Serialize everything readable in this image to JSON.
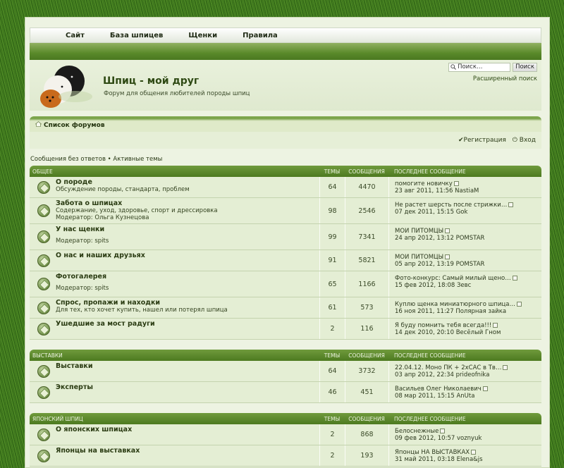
{
  "nav": [
    "Сайт",
    "База шпицев",
    "Щенки",
    "Правила"
  ],
  "site": {
    "title": "Шпиц - мой друг",
    "description": "Форум для общения любителей породы шпиц"
  },
  "search": {
    "placeholder": "Поиск…",
    "button": "Поиск",
    "advanced": "Расширенный поиск"
  },
  "breadcrumb": "Список форумов",
  "user_links": {
    "register": "Регистрация",
    "login": "Вход"
  },
  "quick_links": "Сообщения без ответов • Активные темы",
  "columns": {
    "topics": "ТЕМЫ",
    "posts": "СООБЩЕНИЯ",
    "last_post": "ПОСЛЕДНЕЕ СООБЩЕНИЕ"
  },
  "categories": [
    {
      "name": "ОБЩЕЕ",
      "forums": [
        {
          "name": "О породе",
          "desc": "Обсуждение породы, стандарта, проблем",
          "moderator": "",
          "topics": "64",
          "posts": "4470",
          "last_title": "помогите новичку",
          "last_meta": "23 авг 2011, 11:56 NastiaM"
        },
        {
          "name": "Забота о шпицах",
          "desc": "Содержание, уход, здоровье, спорт и дрессировка",
          "moderator": "Модератор: Ольга Кузнецова",
          "topics": "98",
          "posts": "2546",
          "last_title": "Не растет шерсть после стрижки…",
          "last_meta": "07 дек 2011, 15:15 Gok"
        },
        {
          "name": "У нас щенки",
          "desc": "",
          "moderator": "Модератор: spits",
          "topics": "99",
          "posts": "7341",
          "last_title": "МОИ ПИТОМЦЫ",
          "last_meta": "24 апр 2012, 13:12 POMSTAR"
        },
        {
          "name": "О нас и наших друзьях",
          "desc": "",
          "moderator": "",
          "topics": "91",
          "posts": "5821",
          "last_title": "МОИ ПИТОМЦЫ",
          "last_meta": "05 апр 2012, 13:19 POMSTAR"
        },
        {
          "name": "Фотогалерея",
          "desc": "",
          "moderator": "Модератор: spits",
          "topics": "65",
          "posts": "1166",
          "last_title": "Фото-конкурс: Самый милый щено…",
          "last_meta": "15 фев 2012, 18:08 Зевс"
        },
        {
          "name": "Спрос, пропажи и находки",
          "desc": "Для тех, кто хочет купить, нашел или потерял шпица",
          "moderator": "",
          "topics": "61",
          "posts": "573",
          "last_title": "Куплю щенка миниатюрного шпица…",
          "last_meta": "16 ноя 2011, 11:27 Полярная зайка"
        },
        {
          "name": "Ушедшие за мост радуги",
          "desc": "",
          "moderator": "",
          "topics": "2",
          "posts": "116",
          "last_title": "Я буду помнить тебя всегда!!!",
          "last_meta": "14 дек 2010, 20:10 Весёлый Гном"
        }
      ]
    },
    {
      "name": "ВЫСТАВКИ",
      "forums": [
        {
          "name": "Выставки",
          "desc": "",
          "moderator": "",
          "topics": "64",
          "posts": "3732",
          "last_title": "22.04.12. Моно ПК + 2хСАС в Тв…",
          "last_meta": "03 апр 2012, 22:34 prideofnika"
        },
        {
          "name": "Эксперты",
          "desc": "",
          "moderator": "",
          "topics": "46",
          "posts": "451",
          "last_title": "Васильев Олег Николаевич",
          "last_meta": "08 мар 2011, 15:15 AnUta"
        }
      ]
    },
    {
      "name": "ЯПОНСКИЙ ШПИЦ",
      "forums": [
        {
          "name": "О японских шпицах",
          "desc": "",
          "moderator": "",
          "topics": "2",
          "posts": "868",
          "last_title": "Белоснежные",
          "last_meta": "09 фев 2012, 10:57 voznyuk"
        },
        {
          "name": "Японцы на выставках",
          "desc": "",
          "moderator": "",
          "topics": "2",
          "posts": "193",
          "last_title": "Японцы НА ВЫСТАВКАХ",
          "last_meta": "31 май 2011, 03:18 Elena&js"
        }
      ]
    }
  ]
}
